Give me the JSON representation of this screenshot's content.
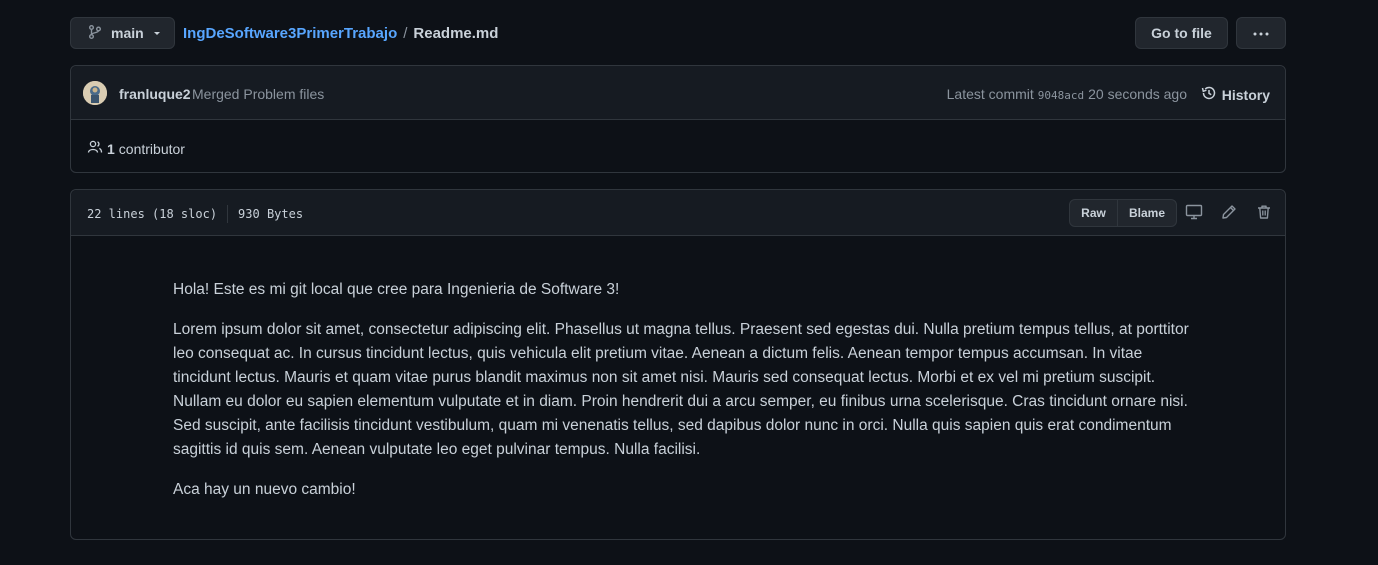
{
  "header": {
    "branch": "main",
    "repo": "IngDeSoftware3PrimerTrabajo",
    "separator": "/",
    "file": "Readme.md",
    "goto_label": "Go to file"
  },
  "commit": {
    "author": "franluque2",
    "message": "Merged Problem files",
    "latest_label": "Latest commit",
    "sha": "9048acd",
    "time": "20 seconds ago",
    "history_label": "History"
  },
  "contributors": {
    "count": "1",
    "label": "contributor"
  },
  "file": {
    "lines": "22 lines (18 sloc)",
    "size": "930 Bytes",
    "raw_label": "Raw",
    "blame_label": "Blame"
  },
  "readme": {
    "paragraphs": [
      "Hola! Este es mi git local que cree para Ingenieria de Software 3!",
      "Lorem ipsum dolor sit amet, consectetur adipiscing elit. Phasellus ut magna tellus. Praesent sed egestas dui. Nulla pretium tempus tellus, at porttitor leo consequat ac. In cursus tincidunt lectus, quis vehicula elit pretium vitae. Aenean a dictum felis. Aenean tempor tempus accumsan. In vitae tincidunt lectus. Mauris et quam vitae purus blandit maximus non sit amet nisi. Mauris sed consequat lectus. Morbi et ex vel mi pretium suscipit. Nullam eu dolor eu sapien elementum vulputate et in diam. Proin hendrerit dui a arcu semper, eu finibus urna scelerisque. Cras tincidunt ornare nisi. Sed suscipit, ante facilisis tincidunt vestibulum, quam mi venenatis tellus, sed dapibus dolor nunc in orci. Nulla quis sapien quis erat condimentum sagittis id quis sem. Aenean vulputate leo eget pulvinar tempus. Nulla facilisi.",
      "Aca hay un nuevo cambio!"
    ]
  },
  "colors": {
    "background": "#0d1117",
    "link": "#58a6ff",
    "border": "#30363d"
  },
  "icons": [
    "git-branch-icon",
    "chevron-down-icon",
    "kebab-horizontal-icon",
    "history-icon",
    "people-icon",
    "desktop-icon",
    "pencil-icon",
    "trash-icon"
  ]
}
